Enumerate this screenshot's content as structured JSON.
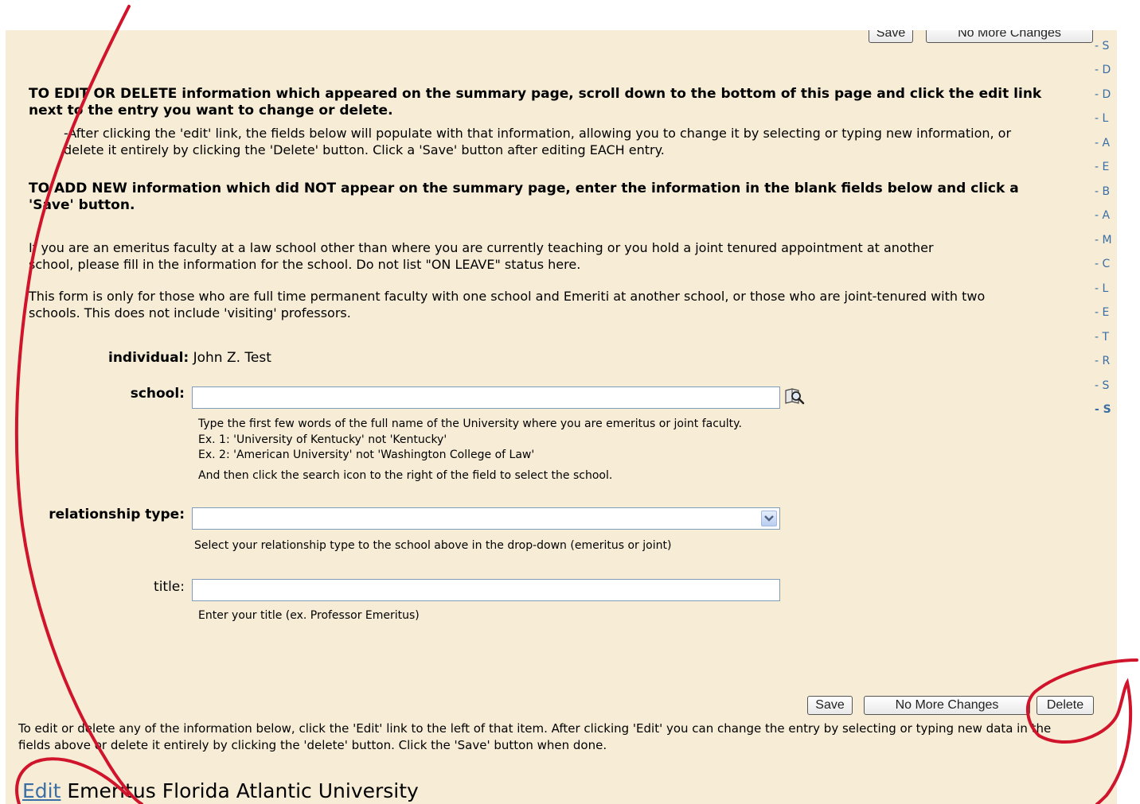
{
  "top_buttons": {
    "save": "Save",
    "no_more_changes": "No More Changes"
  },
  "instructions": {
    "edit_heading": "TO EDIT OR DELETE information which appeared on the summary page, scroll down to the bottom of this page and click the edit link next to the entry you want to change or delete.",
    "edit_note": "-After clicking the 'edit' link, the fields below will populate with that information, allowing you to change it by selecting or typing new information, or delete it entirely by clicking the 'Delete' button.  Click a 'Save' button after editing EACH entry.",
    "add_heading": "TO ADD NEW information which did NOT appear on the summary page, enter the information in the blank fields below and click a 'Save' button.",
    "emeritus_note": "If you are an emeritus faculty at a law school other than where you are currently teaching or you hold a joint tenured appointment at another school, please fill in the information for the school. Do not list \"ON LEAVE\" status here.",
    "form_scope": "This form is only for those who are full time permanent faculty with one school and Emeriti at another school, or those who are joint-tenured with two schools. This does not include 'visiting' professors."
  },
  "form": {
    "individual_label": "individual:",
    "individual_value": "John Z. Test",
    "school_label": "school:",
    "school_value": "",
    "school_help_1": "Type the first few words of the full name of the University where you are emeritus or joint faculty.",
    "school_help_2": "Ex. 1: 'University of Kentucky' not 'Kentucky'",
    "school_help_3": "Ex. 2: 'American University' not 'Washington College of Law'",
    "school_help_4": "And then click the search icon to the right of the field to select the school.",
    "relationship_label": "relationship type:",
    "relationship_value": "",
    "relationship_help": "Select your relationship type to the school above in the drop-down (emeritus or joint)",
    "title_label": "title:",
    "title_value": "",
    "title_help": "Enter your title (ex. Professor Emeritus)"
  },
  "bottom_buttons": {
    "save": "Save",
    "no_more_changes": "No More Changes",
    "delete": "Delete"
  },
  "bottom_note": "To edit or delete any of the information below, click the 'Edit' link to the left of that item. After clicking 'Edit' you can change the entry by selecting or typing new data in the fields above or delete it entirely by clicking the 'delete' button. Click the 'Save' button when done.",
  "entry": {
    "edit_link": "Edit",
    "text": "Emeritus Florida Atlantic University"
  },
  "right_nav": [
    "- S",
    "- D",
    "- D",
    "- L",
    "- A",
    "- E",
    "- B",
    "- A",
    "- M",
    "- C",
    "- L",
    "- E",
    "- T",
    "- R",
    "- S",
    "- S"
  ],
  "colors": {
    "background": "#f7edd6",
    "link": "#3a6ea5",
    "annotation": "#d0142c"
  },
  "icons": {
    "school_search": "search-icon",
    "dropdown": "chevron-down-icon"
  }
}
